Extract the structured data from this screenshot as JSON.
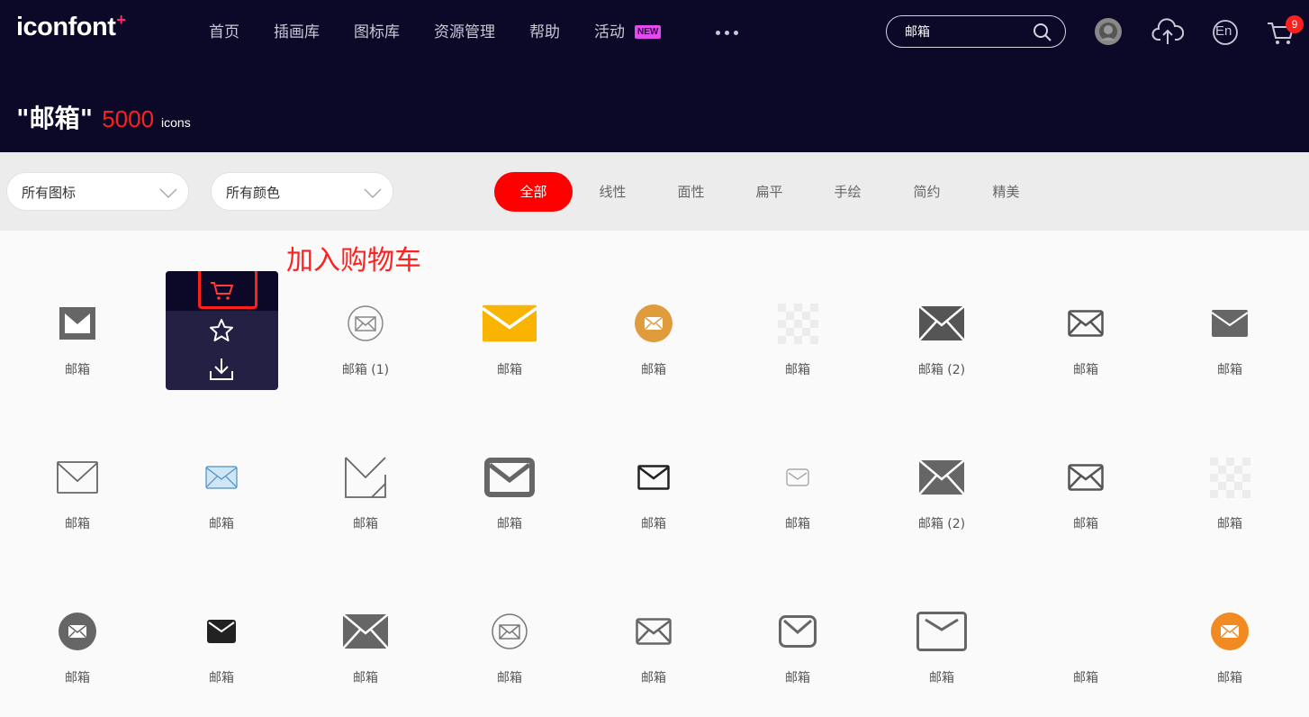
{
  "header": {
    "logo": "iconfont",
    "logo_mark": "+",
    "nav": [
      {
        "label": "首页"
      },
      {
        "label": "插画库"
      },
      {
        "label": "图标库"
      },
      {
        "label": "资源管理"
      },
      {
        "label": "帮助"
      },
      {
        "label": "活动",
        "badge": "NEW"
      }
    ],
    "search": {
      "value": "邮箱"
    },
    "cart_count": "9",
    "lang": "En"
  },
  "result": {
    "query": "\"邮箱\"",
    "count": "5000",
    "unit": "icons"
  },
  "filters": {
    "type_select": "所有图标",
    "color_select": "所有颜色",
    "tabs": [
      {
        "label": "全部",
        "active": true
      },
      {
        "label": "线性"
      },
      {
        "label": "面性"
      },
      {
        "label": "扁平"
      },
      {
        "label": "手绘"
      },
      {
        "label": "简约"
      },
      {
        "label": "精美"
      }
    ]
  },
  "annotation": "加入购物车",
  "icons": [
    {
      "label": "邮箱",
      "style": "square-solid",
      "color": "#666666"
    },
    {
      "label": "邮箱",
      "style": "hovered",
      "color": "#666666"
    },
    {
      "label": "邮箱 (1)",
      "style": "circle-outline",
      "color": "#888888"
    },
    {
      "label": "邮箱",
      "style": "flat-yellow",
      "color": "#f8b400"
    },
    {
      "label": "邮箱",
      "style": "circle-solid",
      "color": "#e09b3d"
    },
    {
      "label": "邮箱",
      "style": "transparent",
      "color": "#dddddd"
    },
    {
      "label": "邮箱 (2)",
      "style": "x-solid",
      "color": "#555555"
    },
    {
      "label": "邮箱",
      "style": "outline",
      "color": "#555555"
    },
    {
      "label": "邮箱",
      "style": "solid",
      "color": "#666666"
    },
    {
      "label": "邮箱",
      "style": "outline-thin",
      "color": "#666666"
    },
    {
      "label": "邮箱",
      "style": "outline-blue",
      "color": "#4a8fc4"
    },
    {
      "label": "邮箱",
      "style": "open-outline",
      "color": "#666666"
    },
    {
      "label": "邮箱",
      "style": "thick-outline",
      "color": "#666666"
    },
    {
      "label": "邮箱",
      "style": "outline-dark",
      "color": "#222222"
    },
    {
      "label": "邮箱",
      "style": "outline-small",
      "color": "#999999"
    },
    {
      "label": "邮箱 (2)",
      "style": "x-solid",
      "color": "#666666"
    },
    {
      "label": "邮箱",
      "style": "outline",
      "color": "#555555"
    },
    {
      "label": "邮箱",
      "style": "transparent",
      "color": "#dddddd"
    },
    {
      "label": "邮箱",
      "style": "circle-solid",
      "color": "#666666"
    },
    {
      "label": "邮箱",
      "style": "solid-dark",
      "color": "#222222"
    },
    {
      "label": "邮箱",
      "style": "x-solid",
      "color": "#666666"
    },
    {
      "label": "邮箱",
      "style": "circle-outline",
      "color": "#777777"
    },
    {
      "label": "邮箱",
      "style": "outline",
      "color": "#666666"
    },
    {
      "label": "邮箱",
      "style": "rounded-outline",
      "color": "#666666"
    },
    {
      "label": "邮箱",
      "style": "wide-outline",
      "color": "#666666"
    },
    {
      "label": "邮箱",
      "style": "blank",
      "color": "#ffffff"
    },
    {
      "label": "邮箱",
      "style": "circle-solid",
      "color": "#f28a22"
    }
  ]
}
